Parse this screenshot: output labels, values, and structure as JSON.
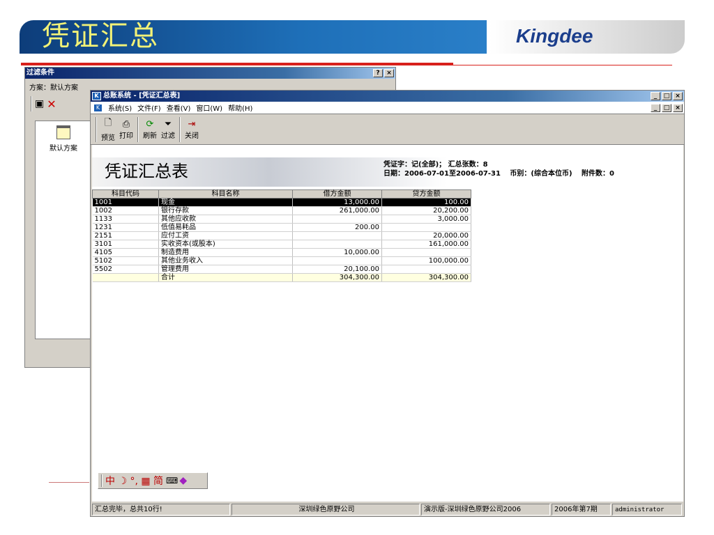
{
  "slide": {
    "title": "凭证汇总",
    "logo": "Kingdee"
  },
  "filter_window": {
    "title": "过滤条件",
    "help": "?",
    "close": "×",
    "scheme_label": "方案：默认方案",
    "item_label": "默认方案"
  },
  "main_window": {
    "title": "总账系统 - [凭证汇总表]",
    "min": "_",
    "max": "□",
    "close": "×"
  },
  "menu": [
    "系统(S)",
    "文件(F)",
    "查看(V)",
    "窗口(W)",
    "帮助(H)"
  ],
  "toolbar": [
    {
      "label": "预览",
      "icon": "preview-icon"
    },
    {
      "label": "打印",
      "icon": "print-icon"
    },
    {
      "label": "刷新",
      "icon": "refresh-icon"
    },
    {
      "label": "过滤",
      "icon": "filter-icon"
    },
    {
      "label": "关闭",
      "icon": "exit-icon"
    }
  ],
  "report": {
    "title": "凭证汇总表",
    "voucher_word": "凭证字：记(全部)；",
    "voucher_count": "汇总张数：8",
    "date_range": "日期：2006-07-01至2006-07-31",
    "currency": "币别：(综合本位币)",
    "attachments": "附件数：0"
  },
  "table": {
    "headers": [
      "科目代码",
      "科目名称",
      "借方金额",
      "贷方金额"
    ],
    "rows": [
      [
        "1001",
        "现金",
        "13,000.00",
        "100.00"
      ],
      [
        "1002",
        "银行存款",
        "261,000.00",
        "20,200.00"
      ],
      [
        "1133",
        "其他应收款",
        "",
        "3,000.00"
      ],
      [
        "1231",
        "低值易耗品",
        "200.00",
        ""
      ],
      [
        "2151",
        "应付工资",
        "",
        "20,000.00"
      ],
      [
        "3101",
        "实收资本(或股本)",
        "",
        "161,000.00"
      ],
      [
        "4105",
        "制造费用",
        "10,000.00",
        ""
      ],
      [
        "5102",
        "其他业务收入",
        "",
        "100,000.00"
      ],
      [
        "5502",
        "管理费用",
        "20,100.00",
        ""
      ]
    ],
    "total": [
      "",
      "合计",
      "304,300.00",
      "304,300.00"
    ]
  },
  "ime": {
    "text": "中 ☽ °, ▦ 简"
  },
  "status": [
    "汇总完毕，总共10行!",
    "深圳绿色原野公司",
    "演示版-深圳绿色原野公司2006",
    "2006年第7期",
    "administrator"
  ]
}
